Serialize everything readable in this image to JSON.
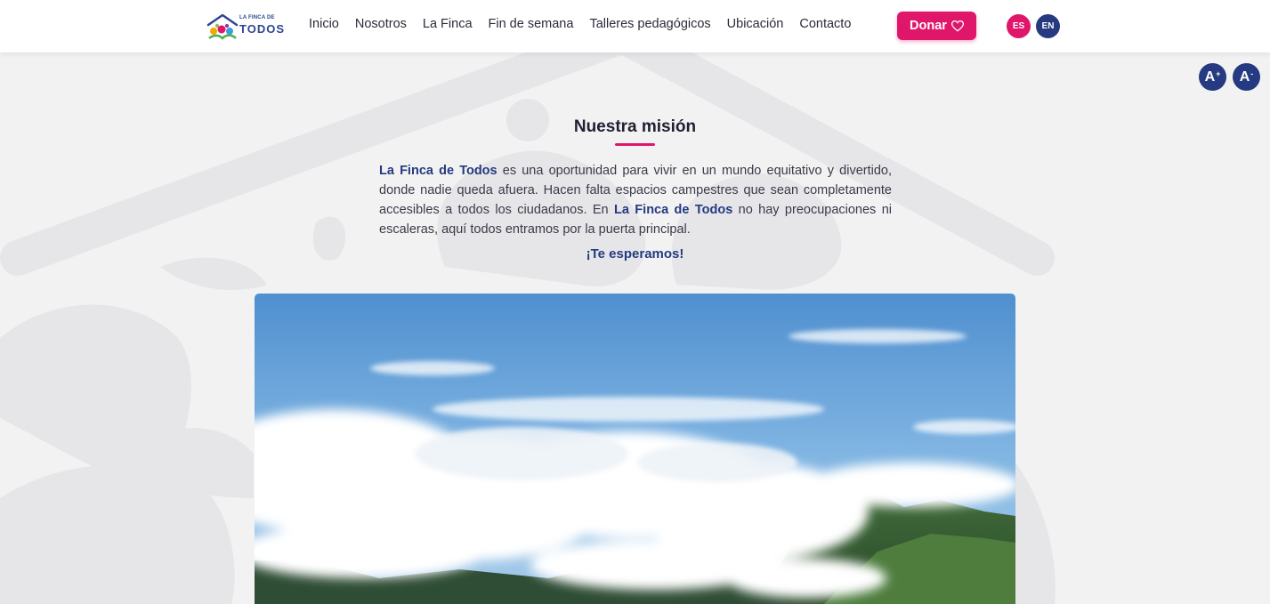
{
  "header": {
    "logo": {
      "line1": "LA FINCA DE",
      "line2": "TODOS"
    },
    "nav": [
      "Inicio",
      "Nosotros",
      "La Finca",
      "Fin de semana",
      "Talleres pedagógicos",
      "Ubicación",
      "Contacto"
    ],
    "donate_label": "Donar",
    "languages": [
      "ES",
      "EN"
    ]
  },
  "font_controls": {
    "increase": "A",
    "decrease": "A"
  },
  "mission": {
    "title": "Nuestra misión",
    "brand": "La Finca de Todos",
    "text_1": " es una oportunidad para vivir en un mundo equitativo y divertido, donde nadie queda afuera. Hacen falta espacios campestres que sean completamente accesibles a todos los ciudadanos. En ",
    "text_2": " no hay preocupaciones ni escaleras, aquí todos entramos por la puerta principal.",
    "welcome": "¡Te esperamos!"
  },
  "colors": {
    "accent_pink": "#e0166b",
    "brand_blue": "#253a80",
    "background": "#f2f2f3"
  },
  "photo": {
    "subject": "mountains-with-clouds"
  }
}
